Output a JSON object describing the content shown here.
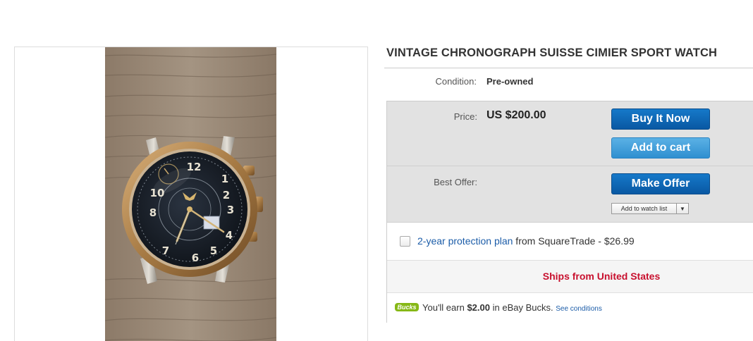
{
  "listing": {
    "title": "VINTAGE CHRONOGRAPH SUISSE CIMIER SPORT WATCH",
    "condition_label": "Condition:",
    "condition_value": "Pre-owned"
  },
  "purchase": {
    "price_label": "Price:",
    "price_value": "US $200.00",
    "buy_it_now_label": "Buy It Now",
    "add_to_cart_label": "Add to cart",
    "best_offer_label": "Best Offer:",
    "make_offer_label": "Make Offer",
    "watch_list_label": "Add to watch list"
  },
  "protection": {
    "link_text": "2-year protection plan",
    "rest_text": " from SquareTrade - $26.99"
  },
  "shipping": {
    "ships_from": "Ships from United States"
  },
  "bucks": {
    "logo_text": "Bucks",
    "earn_prefix": "You'll earn ",
    "earn_amount": "$2.00",
    "earn_suffix": " in eBay Bucks. ",
    "see_conditions": "See conditions"
  },
  "icons": {
    "watch_list_dropdown": "chevron-down-icon",
    "checkbox": "checkbox-icon"
  },
  "colors": {
    "primary_button": "#0958a3",
    "secondary_button": "#2f8fd0",
    "ships_text": "#c8102e",
    "link": "#1b5ca8",
    "bucks_green": "#86b817"
  }
}
